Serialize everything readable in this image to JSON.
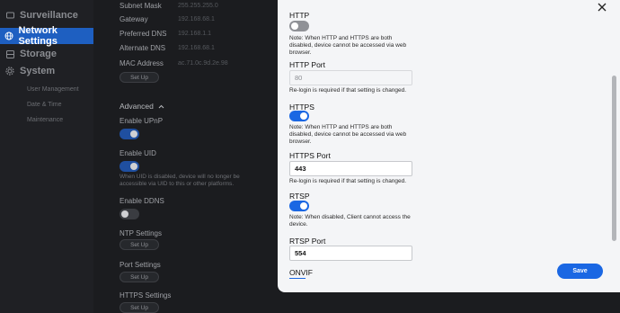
{
  "sidebar": {
    "items": [
      {
        "label": "Surveillance",
        "icon": "camera-icon"
      },
      {
        "label": "Network Settings",
        "icon": "globe-icon"
      },
      {
        "label": "Storage",
        "icon": "storage-icon"
      },
      {
        "label": "System",
        "icon": "gear-icon"
      }
    ],
    "sub_items": [
      "User Management",
      "Date & Time",
      "Maintenance"
    ]
  },
  "network_info": {
    "subnet_mask": {
      "label": "Subnet Mask",
      "value": "255.255.255.0"
    },
    "gateway": {
      "label": "Gateway",
      "value": "192.168.68.1"
    },
    "preferred_dns": {
      "label": "Preferred DNS",
      "value": "192.168.1.1"
    },
    "alternate_dns": {
      "label": "Alternate DNS",
      "value": "192.168.68.1"
    },
    "mac_address": {
      "label": "MAC Address",
      "value": "ac.71.0c.9d.2e.98"
    },
    "setup_label": "Set Up"
  },
  "advanced": {
    "heading": "Advanced",
    "upnp_label": "Enable UPnP",
    "uid_label": "Enable UID",
    "uid_note": "When UID is disabled, device will no longer be accessible via UID to this or other platforms.",
    "ddns_label": "Enable DDNS",
    "ntp_label": "NTP Settings",
    "port_label": "Port Settings",
    "https_label": "HTTPS Settings",
    "setup_label": "Set Up"
  },
  "dialog": {
    "http": {
      "label": "HTTP",
      "enabled": false,
      "note": "Note: When HTTP and HTTPS are both disabled, device cannot be accessed via web browser."
    },
    "http_port": {
      "label": "HTTP Port",
      "value": "80",
      "note": "Re-login is required if that setting is changed."
    },
    "https": {
      "label": "HTTPS",
      "enabled": true,
      "note": "Note: When HTTP and HTTPS are both disabled, device cannot be accessed via web browser."
    },
    "https_port": {
      "label": "HTTPS Port",
      "value": "443",
      "note": "Re-login is required if that setting is changed."
    },
    "rtsp": {
      "label": "RTSP",
      "enabled": true,
      "note": "Note: When disabled, Client cannot access the device."
    },
    "rtsp_port": {
      "label": "RTSP Port",
      "value": "554"
    },
    "onvif_label": "ONVIF",
    "save_label": "Save",
    "close_icon": "close-icon"
  },
  "colors": {
    "accent": "#1a67e3",
    "sidebar_active": "#1e5fc1",
    "dialog_bg": "#f4f5f7",
    "page_bg": "#1b1c1f"
  }
}
